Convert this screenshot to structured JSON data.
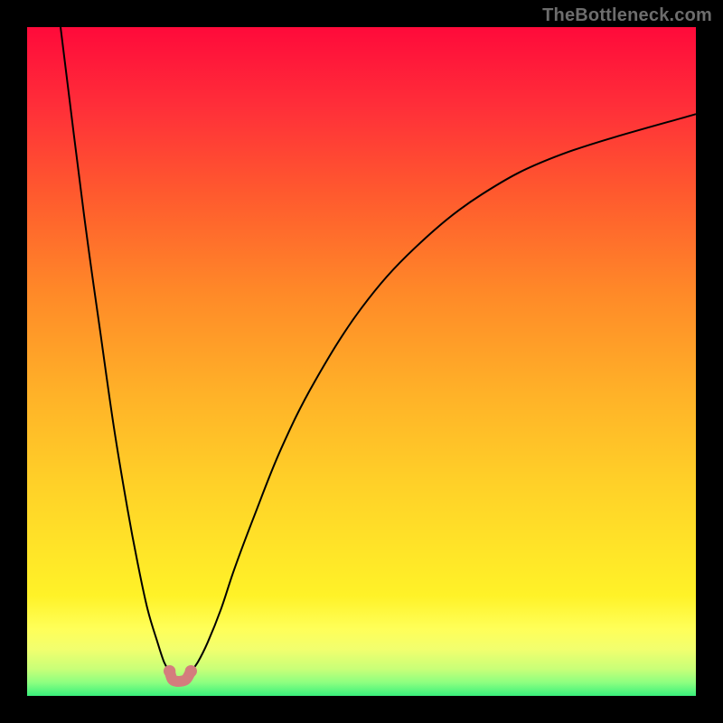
{
  "watermark": "TheBottleneck.com",
  "chart_data": {
    "type": "line",
    "title": "",
    "xlabel": "",
    "ylabel": "",
    "xlim": [
      0,
      100
    ],
    "ylim": [
      0,
      100
    ],
    "grid": false,
    "legend": false,
    "series": [
      {
        "name": "left-branch",
        "x": [
          5,
          8.5,
          11,
          13,
          15,
          16.5,
          18,
          19.5,
          20.5,
          21.3
        ],
        "y": [
          100,
          72,
          54,
          40,
          28,
          20,
          13,
          8,
          5,
          3.7
        ],
        "stroke": "#000000"
      },
      {
        "name": "right-branch",
        "x": [
          24.5,
          25.5,
          27,
          29,
          31,
          34,
          38,
          43,
          50,
          58,
          68,
          80,
          100
        ],
        "y": [
          3.7,
          5,
          8,
          13,
          19,
          27,
          37,
          47,
          58,
          67,
          75,
          81,
          87
        ],
        "stroke": "#000000"
      },
      {
        "name": "valley-fill",
        "x": [
          21.3,
          21.7,
          22.3,
          23.0,
          23.8,
          24.5
        ],
        "y": [
          3.7,
          2.5,
          2.2,
          2.2,
          2.5,
          3.7
        ],
        "stroke": "#d47d7d"
      }
    ],
    "markers": [
      {
        "name": "marker-left",
        "x": 21.3,
        "y": 3.7,
        "r": 0.9,
        "fill": "#d47d7d"
      },
      {
        "name": "marker-right",
        "x": 24.5,
        "y": 3.7,
        "r": 0.9,
        "fill": "#d47d7d"
      }
    ],
    "background_gradient": {
      "direction": "top-to-bottom",
      "stops": [
        {
          "pos": 0.0,
          "color": "#ff0a3a"
        },
        {
          "pos": 0.4,
          "color": "#ff8a28"
        },
        {
          "pos": 0.8,
          "color": "#ffe428"
        },
        {
          "pos": 1.0,
          "color": "#39f07c"
        }
      ]
    }
  }
}
